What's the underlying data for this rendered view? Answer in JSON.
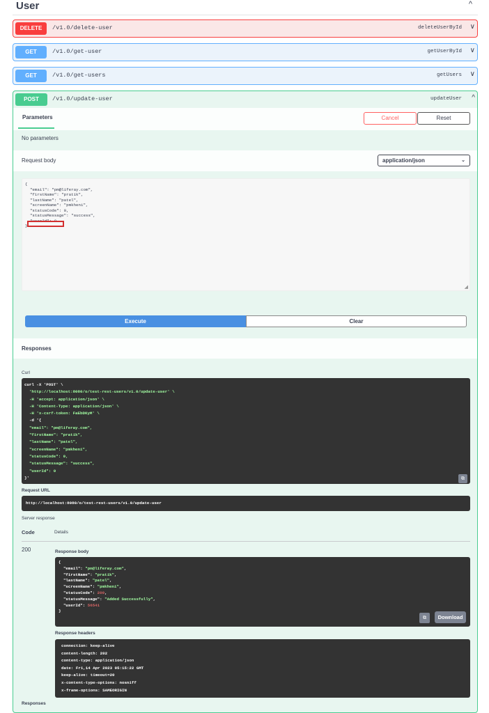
{
  "tag": {
    "title": "User",
    "chevron": "^"
  },
  "operations": [
    {
      "method": "DELETE",
      "path": "/v1.0/delete-user",
      "operation_id": "deleteUserById",
      "chevron": "∨"
    },
    {
      "method": "GET",
      "path": "/v1.0/get-user",
      "operation_id": "getUserById",
      "chevron": "∨"
    },
    {
      "method": "GET",
      "path": "/v1.0/get-users",
      "operation_id": "getUsers",
      "chevron": "∨"
    },
    {
      "method": "POST",
      "path": "/v1.0/update-user",
      "operation_id": "updateUser",
      "chevron": "^"
    }
  ],
  "post_panel": {
    "params_tab": "Parameters",
    "cancel_label": "Cancel",
    "reset_label": "Reset",
    "no_params": "No parameters",
    "request_body_label": "Request body",
    "content_type": "application/json",
    "content_type_chevron": "⌄",
    "body_lines": [
      "{",
      "  \"email\": \"pm@liferay.com\",",
      "  \"firstName\": \"pratik\",",
      "  \"lastName\": \"patel\",",
      "  \"screenName\": \"pmkheni\",",
      "  \"statusCode\": 0,",
      "  \"statusMessage\": \"success\",",
      "  \"userId\": 0",
      "}"
    ],
    "execute_label": "Execute",
    "clear_label": "Clear",
    "responses_title": "Responses",
    "curl_label": "Curl",
    "curl_lines": [
      "curl -X 'POST' \\",
      "  'http://localhost:8080/o/test-rest-users/v1.0/update-user' \\",
      "  -H 'accept: application/json' \\",
      "  -H 'Content-Type: application/json' \\",
      "  -H 'x-csrf-token: FaEbDKyM' \\",
      "  -d '{",
      "  \"email\": \"pm@liferay.com\",",
      "  \"firstName\": \"pratik\",",
      "  \"lastName\": \"patel\",",
      "  \"screenName\": \"pmkheni\",",
      "  \"statusCode\": 0,",
      "  \"statusMessage\": \"success\",",
      "  \"userId\": 0",
      "}'"
    ],
    "request_url_label": "Request URL",
    "request_url": "http://localhost:8080/o/test-rest-users/v1.0/update-user",
    "server_response_label": "Server response",
    "code_header": "Code",
    "details_header": "Details",
    "code": "200",
    "response_body_label": "Response body",
    "response_body": {
      "open": "{",
      "email_key": "  \"email\": ",
      "email_val": "\"pm@liferay.com\"",
      "firstName_key": "  \"firstName\": ",
      "firstName_val": "\"pratik\"",
      "lastName_key": "  \"lastName\": ",
      "lastName_val": "\"patel\"",
      "screenName_key": "  \"screenName\": ",
      "screenName_val": "\"pmkheni\"",
      "statusCode_key": "  \"statusCode\": ",
      "statusCode_val": "200",
      "statusMessage_key": "  \"statusMessage\": ",
      "statusMessage_val": "\"Added Successfully\"",
      "userId_key": "  \"userId\": ",
      "userId_val": "56541",
      "close": "}"
    },
    "download_label": "Download",
    "response_headers_label": "Response headers",
    "response_headers": [
      "connection: keep-alive",
      "content-length: 202",
      "content-type: application/json",
      "date: Fri,14 Apr 2023 05:15:22 GMT",
      "keep-alive: timeout=20",
      "x-content-type-options: nosniff",
      "x-frame-options: SAMEORIGIN"
    ],
    "responses_bottom_label": "Responses"
  },
  "colors": {
    "delete": "#f93e3e",
    "get": "#61affe",
    "post": "#49cc90",
    "execute": "#4990e2",
    "cancel": "#ff6060",
    "code_bg": "#333333",
    "highlight": "#d32f2f"
  }
}
